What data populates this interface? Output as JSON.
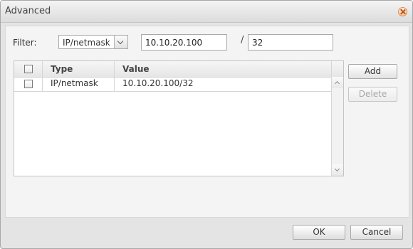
{
  "window": {
    "title": "Advanced",
    "close_icon": "close-icon"
  },
  "filter": {
    "label": "Filter:",
    "type_selected": "IP/netmask",
    "ip_value": "10.10.20.100",
    "slash": "/",
    "mask_value": "32"
  },
  "table": {
    "columns": [
      "Type",
      "Value"
    ],
    "rows": [
      {
        "checked": false,
        "type": "IP/netmask",
        "value": "10.10.20.100/32"
      }
    ]
  },
  "actions": {
    "add_label": "Add",
    "delete_label": "Delete",
    "delete_enabled": false
  },
  "footer": {
    "ok_label": "OK",
    "cancel_label": "Cancel"
  },
  "colors": {
    "dialog_bg": "#e4e4e4",
    "panel_bg": "#f4f4f4",
    "close_accent": "#d98b4c"
  }
}
